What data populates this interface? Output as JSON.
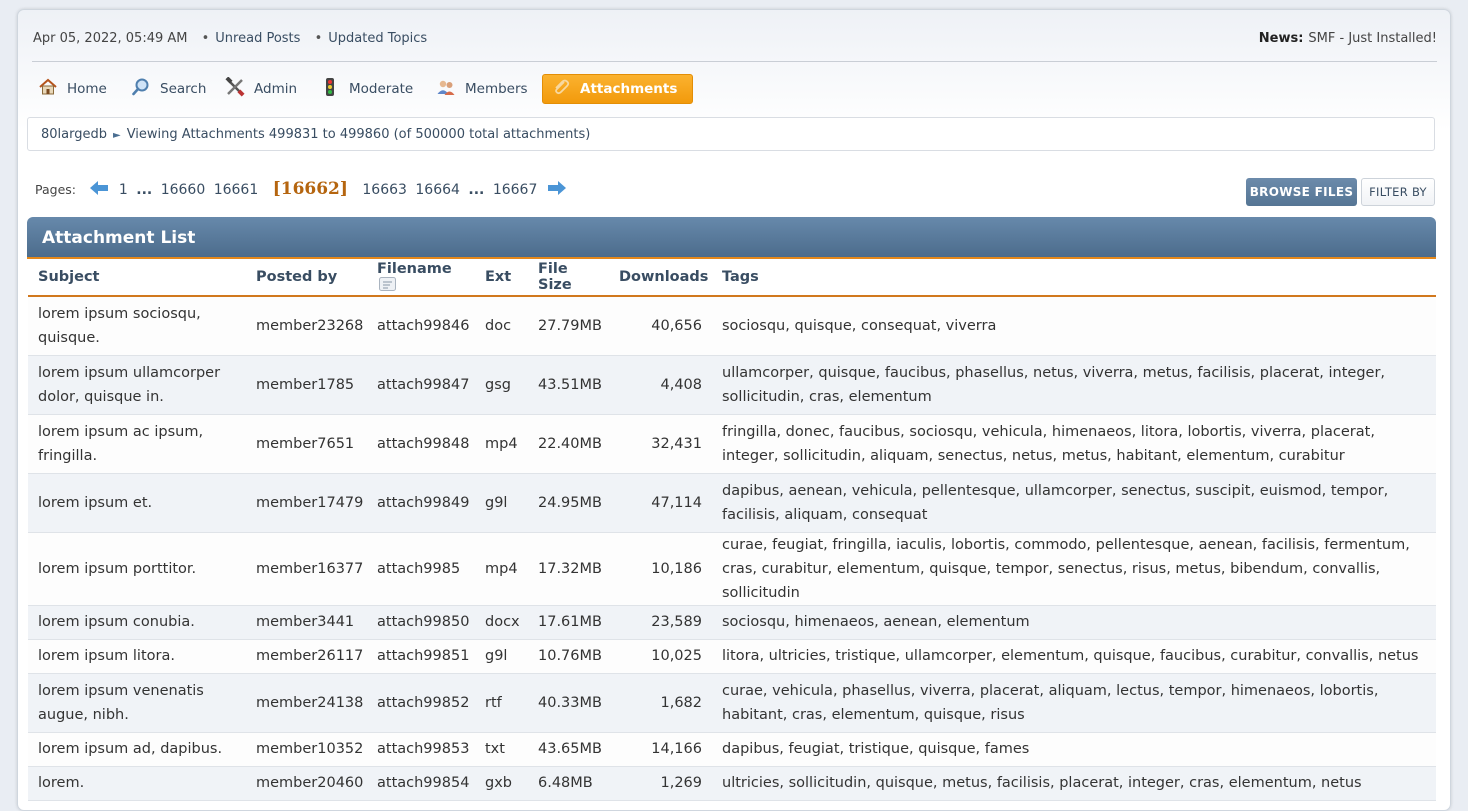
{
  "topbar": {
    "date": "Apr 05, 2022, 05:49 AM",
    "unread": "Unread Posts",
    "updated": "Updated Topics",
    "news_label": "News:",
    "news_text": "SMF - Just Installed!"
  },
  "menu": {
    "home": "Home",
    "search": "Search",
    "admin": "Admin",
    "moderate": "Moderate",
    "members": "Members",
    "attachments": "Attachments"
  },
  "linktree": {
    "forum": "80largedb",
    "current": "Viewing Attachments 499831 to 499860 (of 500000 total attachments)"
  },
  "pagination": {
    "label": "Pages:",
    "pages": [
      "1",
      "...",
      "16660",
      "16661",
      "[16662]",
      "16663",
      "16664",
      "...",
      "16667"
    ]
  },
  "buttons": {
    "browse": "BROWSE FILES",
    "filter": "FILTER BY"
  },
  "list": {
    "title": "Attachment List",
    "headers": [
      "Subject",
      "Posted by",
      "Filename",
      "Ext",
      "File Size",
      "Downloads",
      "Tags"
    ],
    "rows": [
      {
        "subject": "lorem ipsum sociosqu, quisque.",
        "poster": "member23268",
        "filename": "attach99846",
        "ext": "doc",
        "size": "27.79MB",
        "downloads": "40,656",
        "tags": "sociosqu, quisque, consequat, viverra"
      },
      {
        "subject": "lorem ipsum ullamcorper dolor, quisque in.",
        "poster": "member1785",
        "filename": "attach99847",
        "ext": "gsg",
        "size": "43.51MB",
        "downloads": "4,408",
        "tags": "ullamcorper, quisque, faucibus, phasellus, netus, viverra, metus, facilisis, placerat, integer, sollicitudin, cras, elementum"
      },
      {
        "subject": "lorem ipsum ac ipsum, fringilla.",
        "poster": "member7651",
        "filename": "attach99848",
        "ext": "mp4",
        "size": "22.40MB",
        "downloads": "32,431",
        "tags": "fringilla, donec, faucibus, sociosqu, vehicula, himenaeos, litora, lobortis, viverra, placerat, integer, sollicitudin, aliquam, senectus, netus, metus, habitant, elementum, curabitur"
      },
      {
        "subject": "lorem ipsum et.",
        "poster": "member17479",
        "filename": "attach99849",
        "ext": "g9l",
        "size": "24.95MB",
        "downloads": "47,114",
        "tags": "dapibus, aenean, vehicula, pellentesque, ullamcorper, senectus, suscipit, euismod, tempor, facilisis, aliquam, consequat"
      },
      {
        "subject": "lorem ipsum porttitor.",
        "poster": "member16377",
        "filename": "attach9985",
        "ext": "mp4",
        "size": "17.32MB",
        "downloads": "10,186",
        "tags": "curae, feugiat, fringilla, iaculis, lobortis, commodo, pellentesque, aenean, facilisis, fermentum, cras, curabitur, elementum, quisque, tempor, senectus, risus, metus, bibendum, convallis, sollicitudin"
      },
      {
        "subject": "lorem ipsum conubia.",
        "poster": "member3441",
        "filename": "attach99850",
        "ext": "docx",
        "size": "17.61MB",
        "downloads": "23,589",
        "tags": "sociosqu, himenaeos, aenean, elementum"
      },
      {
        "subject": "lorem ipsum litora.",
        "poster": "member26117",
        "filename": "attach99851",
        "ext": "g9l",
        "size": "10.76MB",
        "downloads": "10,025",
        "tags": "litora, ultricies, tristique, ullamcorper, elementum, quisque, faucibus, curabitur, convallis, netus"
      },
      {
        "subject": "lorem ipsum venenatis augue, nibh.",
        "poster": "member24138",
        "filename": "attach99852",
        "ext": "rtf",
        "size": "40.33MB",
        "downloads": "1,682",
        "tags": "curae, vehicula, phasellus, viverra, placerat, aliquam, lectus, tempor, himenaeos, lobortis, habitant, cras, elementum, quisque, risus"
      },
      {
        "subject": "lorem ipsum ad, dapibus.",
        "poster": "member10352",
        "filename": "attach99853",
        "ext": "txt",
        "size": "43.65MB",
        "downloads": "14,166",
        "tags": "dapibus, feugiat, tristique, quisque, fames"
      },
      {
        "subject": "lorem.",
        "poster": "member20460",
        "filename": "attach99854",
        "ext": "gxb",
        "size": "6.48MB",
        "downloads": "1,269",
        "tags": "ultricies, sollicitudin, quisque, metus, facilisis, placerat, integer, cras, elementum, netus"
      }
    ]
  }
}
